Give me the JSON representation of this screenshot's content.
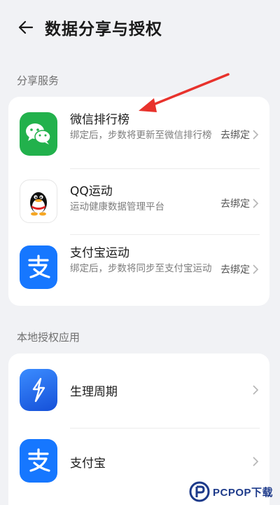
{
  "header": {
    "title": "数据分享与授权"
  },
  "share_services": {
    "label": "分享服务",
    "items": [
      {
        "title": "微信排行榜",
        "desc": "绑定后，步数将更新至微信排行榜",
        "action": "去绑定",
        "icon": "wechat-icon"
      },
      {
        "title": "QQ运动",
        "desc": "运动健康数据管理平台",
        "action": "去绑定",
        "icon": "qq-icon"
      },
      {
        "title": "支付宝运动",
        "desc": "绑定后，步数将同步至支付宝运动",
        "action": "去绑定",
        "icon": "alipay-icon"
      }
    ]
  },
  "local_apps": {
    "label": "本地授权应用",
    "items": [
      {
        "title": "生理周期",
        "icon": "period-tracker-icon"
      },
      {
        "title": "支付宝",
        "icon": "alipay-icon"
      }
    ]
  },
  "watermark": {
    "text": "PCPOP下载"
  },
  "colors": {
    "wechat_green": "#22b14c",
    "alipay_blue": "#1677ff",
    "period_blue": "#1e6ce8",
    "arrow_red": "#e8322c"
  }
}
